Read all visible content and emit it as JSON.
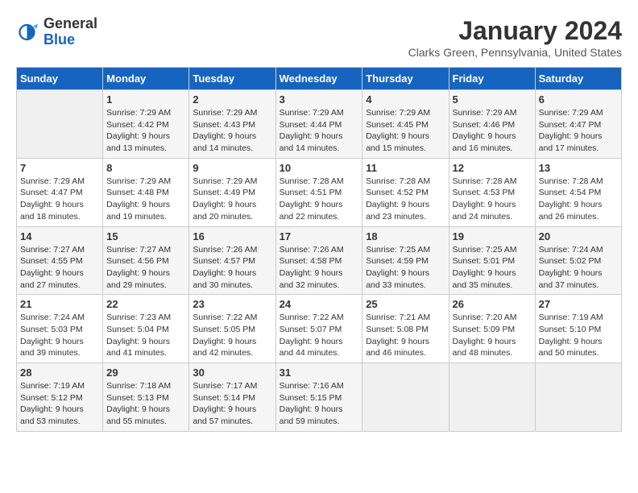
{
  "header": {
    "logo_line1": "General",
    "logo_line2": "Blue",
    "month_title": "January 2024",
    "location": "Clarks Green, Pennsylvania, United States"
  },
  "days_of_week": [
    "Sunday",
    "Monday",
    "Tuesday",
    "Wednesday",
    "Thursday",
    "Friday",
    "Saturday"
  ],
  "weeks": [
    [
      {
        "day": "",
        "sunrise": "",
        "sunset": "",
        "daylight": "",
        "empty": true
      },
      {
        "day": "1",
        "sunrise": "Sunrise: 7:29 AM",
        "sunset": "Sunset: 4:42 PM",
        "daylight": "Daylight: 9 hours and 13 minutes."
      },
      {
        "day": "2",
        "sunrise": "Sunrise: 7:29 AM",
        "sunset": "Sunset: 4:43 PM",
        "daylight": "Daylight: 9 hours and 14 minutes."
      },
      {
        "day": "3",
        "sunrise": "Sunrise: 7:29 AM",
        "sunset": "Sunset: 4:44 PM",
        "daylight": "Daylight: 9 hours and 14 minutes."
      },
      {
        "day": "4",
        "sunrise": "Sunrise: 7:29 AM",
        "sunset": "Sunset: 4:45 PM",
        "daylight": "Daylight: 9 hours and 15 minutes."
      },
      {
        "day": "5",
        "sunrise": "Sunrise: 7:29 AM",
        "sunset": "Sunset: 4:46 PM",
        "daylight": "Daylight: 9 hours and 16 minutes."
      },
      {
        "day": "6",
        "sunrise": "Sunrise: 7:29 AM",
        "sunset": "Sunset: 4:47 PM",
        "daylight": "Daylight: 9 hours and 17 minutes."
      }
    ],
    [
      {
        "day": "7",
        "sunrise": "Sunrise: 7:29 AM",
        "sunset": "Sunset: 4:47 PM",
        "daylight": "Daylight: 9 hours and 18 minutes."
      },
      {
        "day": "8",
        "sunrise": "Sunrise: 7:29 AM",
        "sunset": "Sunset: 4:48 PM",
        "daylight": "Daylight: 9 hours and 19 minutes."
      },
      {
        "day": "9",
        "sunrise": "Sunrise: 7:29 AM",
        "sunset": "Sunset: 4:49 PM",
        "daylight": "Daylight: 9 hours and 20 minutes."
      },
      {
        "day": "10",
        "sunrise": "Sunrise: 7:28 AM",
        "sunset": "Sunset: 4:51 PM",
        "daylight": "Daylight: 9 hours and 22 minutes."
      },
      {
        "day": "11",
        "sunrise": "Sunrise: 7:28 AM",
        "sunset": "Sunset: 4:52 PM",
        "daylight": "Daylight: 9 hours and 23 minutes."
      },
      {
        "day": "12",
        "sunrise": "Sunrise: 7:28 AM",
        "sunset": "Sunset: 4:53 PM",
        "daylight": "Daylight: 9 hours and 24 minutes."
      },
      {
        "day": "13",
        "sunrise": "Sunrise: 7:28 AM",
        "sunset": "Sunset: 4:54 PM",
        "daylight": "Daylight: 9 hours and 26 minutes."
      }
    ],
    [
      {
        "day": "14",
        "sunrise": "Sunrise: 7:27 AM",
        "sunset": "Sunset: 4:55 PM",
        "daylight": "Daylight: 9 hours and 27 minutes."
      },
      {
        "day": "15",
        "sunrise": "Sunrise: 7:27 AM",
        "sunset": "Sunset: 4:56 PM",
        "daylight": "Daylight: 9 hours and 29 minutes."
      },
      {
        "day": "16",
        "sunrise": "Sunrise: 7:26 AM",
        "sunset": "Sunset: 4:57 PM",
        "daylight": "Daylight: 9 hours and 30 minutes."
      },
      {
        "day": "17",
        "sunrise": "Sunrise: 7:26 AM",
        "sunset": "Sunset: 4:58 PM",
        "daylight": "Daylight: 9 hours and 32 minutes."
      },
      {
        "day": "18",
        "sunrise": "Sunrise: 7:25 AM",
        "sunset": "Sunset: 4:59 PM",
        "daylight": "Daylight: 9 hours and 33 minutes."
      },
      {
        "day": "19",
        "sunrise": "Sunrise: 7:25 AM",
        "sunset": "Sunset: 5:01 PM",
        "daylight": "Daylight: 9 hours and 35 minutes."
      },
      {
        "day": "20",
        "sunrise": "Sunrise: 7:24 AM",
        "sunset": "Sunset: 5:02 PM",
        "daylight": "Daylight: 9 hours and 37 minutes."
      }
    ],
    [
      {
        "day": "21",
        "sunrise": "Sunrise: 7:24 AM",
        "sunset": "Sunset: 5:03 PM",
        "daylight": "Daylight: 9 hours and 39 minutes."
      },
      {
        "day": "22",
        "sunrise": "Sunrise: 7:23 AM",
        "sunset": "Sunset: 5:04 PM",
        "daylight": "Daylight: 9 hours and 41 minutes."
      },
      {
        "day": "23",
        "sunrise": "Sunrise: 7:22 AM",
        "sunset": "Sunset: 5:05 PM",
        "daylight": "Daylight: 9 hours and 42 minutes."
      },
      {
        "day": "24",
        "sunrise": "Sunrise: 7:22 AM",
        "sunset": "Sunset: 5:07 PM",
        "daylight": "Daylight: 9 hours and 44 minutes."
      },
      {
        "day": "25",
        "sunrise": "Sunrise: 7:21 AM",
        "sunset": "Sunset: 5:08 PM",
        "daylight": "Daylight: 9 hours and 46 minutes."
      },
      {
        "day": "26",
        "sunrise": "Sunrise: 7:20 AM",
        "sunset": "Sunset: 5:09 PM",
        "daylight": "Daylight: 9 hours and 48 minutes."
      },
      {
        "day": "27",
        "sunrise": "Sunrise: 7:19 AM",
        "sunset": "Sunset: 5:10 PM",
        "daylight": "Daylight: 9 hours and 50 minutes."
      }
    ],
    [
      {
        "day": "28",
        "sunrise": "Sunrise: 7:19 AM",
        "sunset": "Sunset: 5:12 PM",
        "daylight": "Daylight: 9 hours and 53 minutes."
      },
      {
        "day": "29",
        "sunrise": "Sunrise: 7:18 AM",
        "sunset": "Sunset: 5:13 PM",
        "daylight": "Daylight: 9 hours and 55 minutes."
      },
      {
        "day": "30",
        "sunrise": "Sunrise: 7:17 AM",
        "sunset": "Sunset: 5:14 PM",
        "daylight": "Daylight: 9 hours and 57 minutes."
      },
      {
        "day": "31",
        "sunrise": "Sunrise: 7:16 AM",
        "sunset": "Sunset: 5:15 PM",
        "daylight": "Daylight: 9 hours and 59 minutes."
      },
      {
        "day": "",
        "sunrise": "",
        "sunset": "",
        "daylight": "",
        "empty": true
      },
      {
        "day": "",
        "sunrise": "",
        "sunset": "",
        "daylight": "",
        "empty": true
      },
      {
        "day": "",
        "sunrise": "",
        "sunset": "",
        "daylight": "",
        "empty": true
      }
    ]
  ]
}
